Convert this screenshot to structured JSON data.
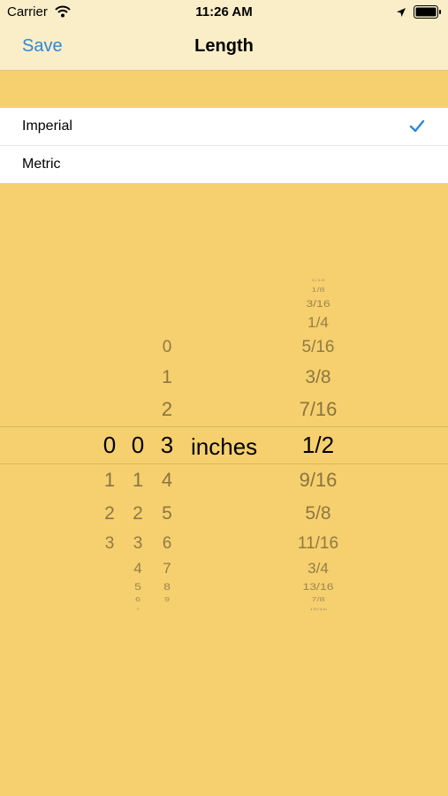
{
  "status_bar": {
    "carrier": "Carrier",
    "time": "11:26 AM"
  },
  "nav": {
    "save_label": "Save",
    "title": "Length"
  },
  "units": {
    "options": [
      {
        "label": "Imperial",
        "selected": true
      },
      {
        "label": "Metric",
        "selected": false
      }
    ]
  },
  "picker": {
    "unit_label": "inches",
    "column1": {
      "values": [
        "0",
        "1",
        "2",
        "3"
      ],
      "selected": "0"
    },
    "column2": {
      "values": [
        "0",
        "1",
        "2",
        "3",
        "4",
        "5",
        "6",
        "7"
      ],
      "selected": "0"
    },
    "column3": {
      "values": [
        "0",
        "1",
        "2",
        "3",
        "4",
        "5",
        "6",
        "7",
        "8",
        "9"
      ],
      "selected": "3"
    },
    "fraction_column": {
      "values": [
        "1/16",
        "1/8",
        "3/16",
        "1/4",
        "5/16",
        "3/8",
        "7/16",
        "1/2",
        "9/16",
        "5/8",
        "11/16",
        "3/4",
        "13/16",
        "7/8",
        "15/16"
      ],
      "selected": "1/2"
    }
  },
  "colors": {
    "accent": "#2f87d7",
    "background": "#f6d06e",
    "bar": "#faeec9"
  }
}
